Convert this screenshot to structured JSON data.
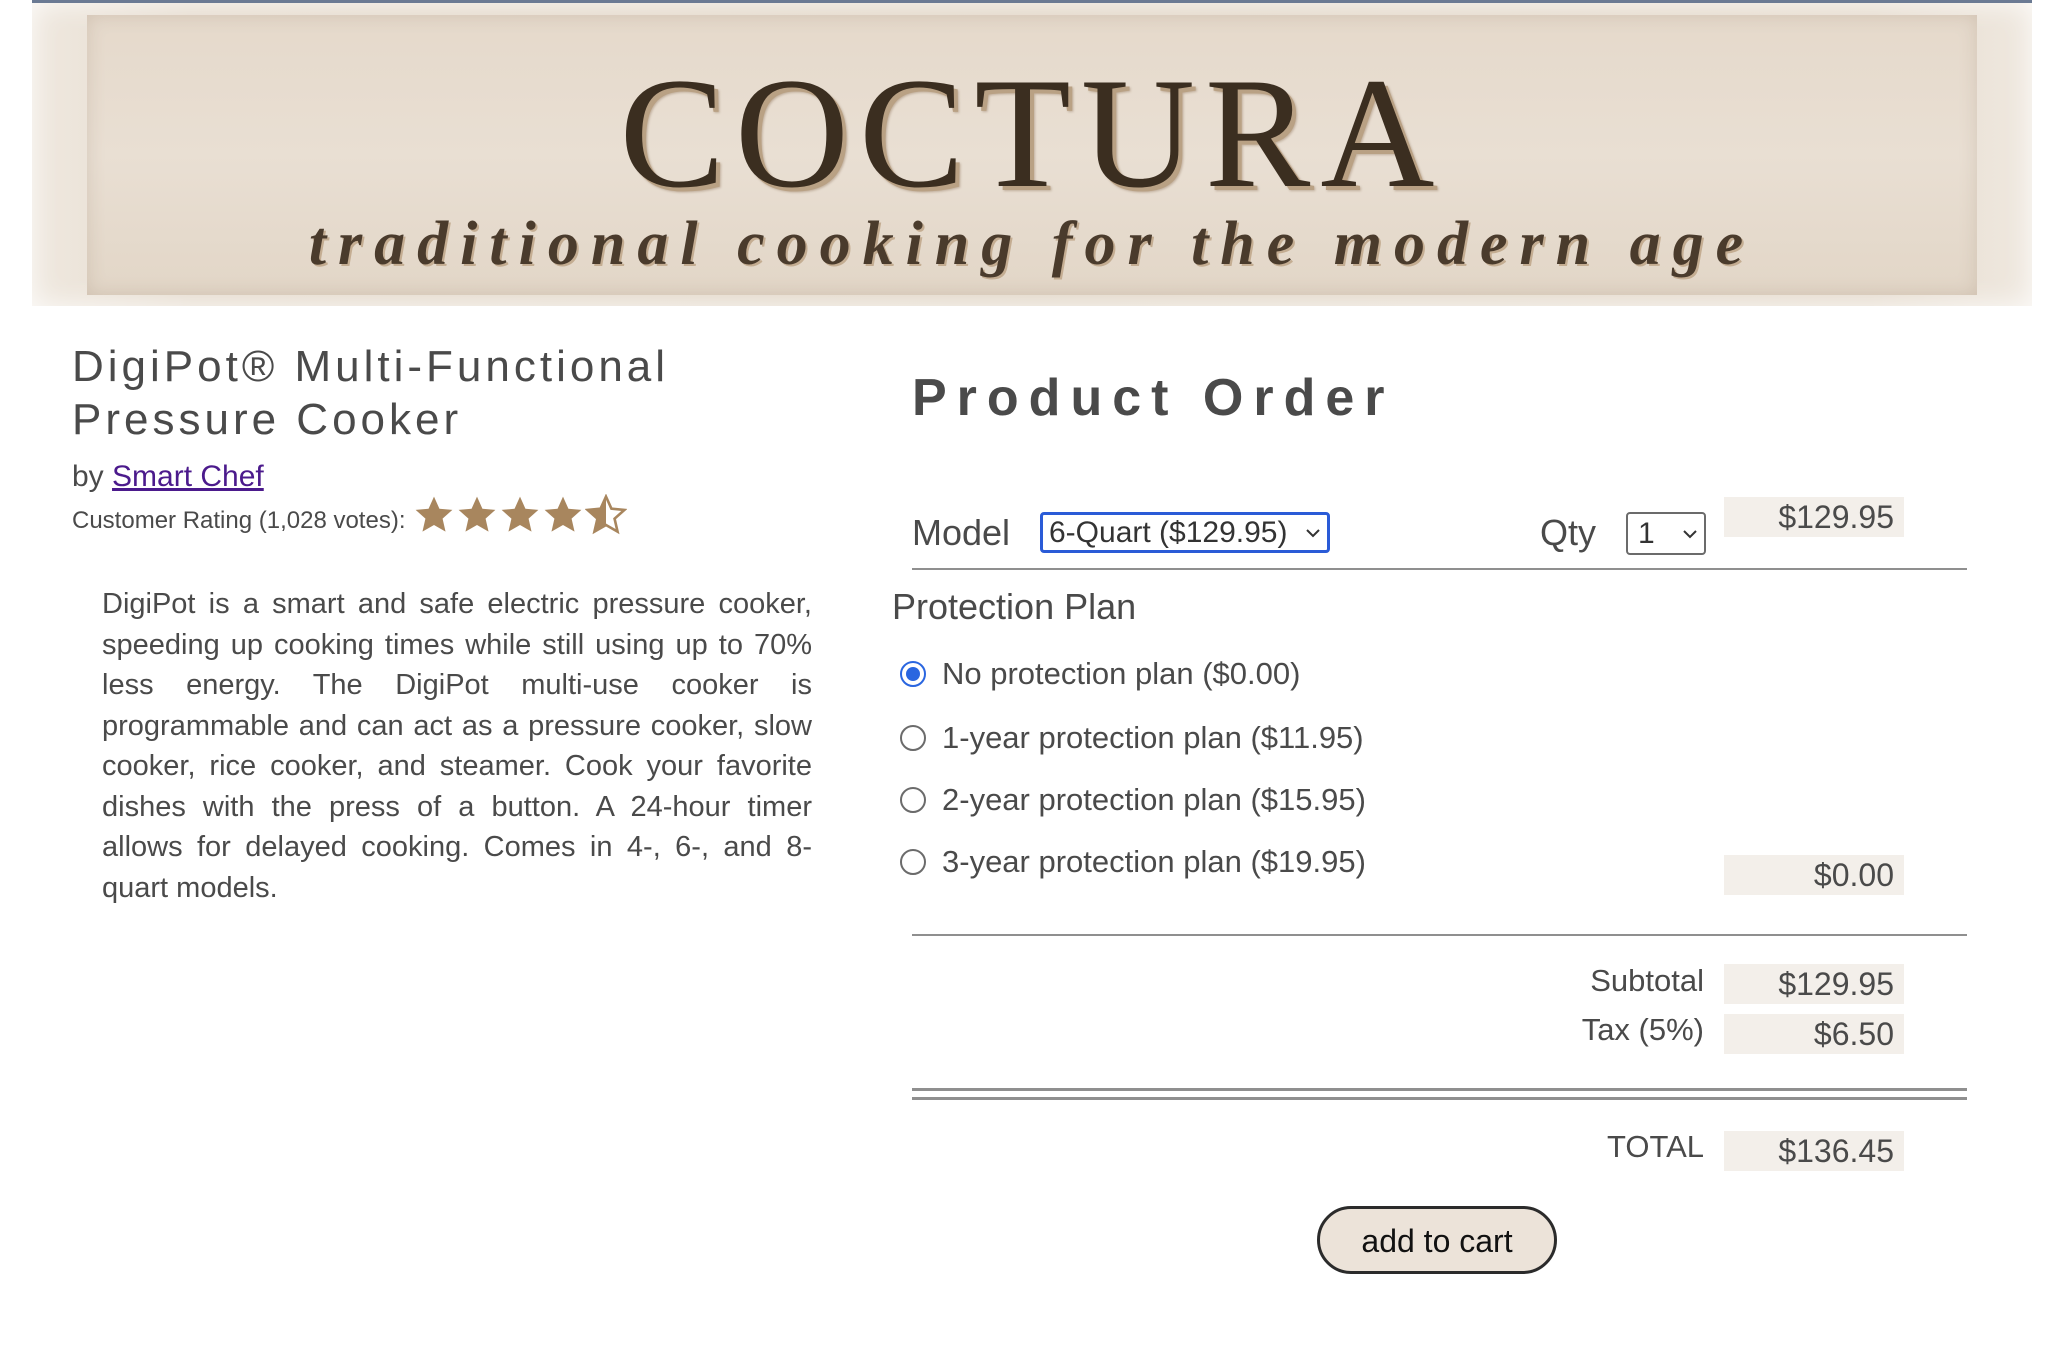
{
  "banner": {
    "brand": "COCTURA",
    "tagline": "traditional cooking for the modern age"
  },
  "product": {
    "title": "DigiPot® Multi-Functional Pressure Cooker",
    "by_prefix": "by",
    "brand_link": "Smart Chef",
    "rating_label": "Customer Rating (1,028 votes):",
    "rating": 4.5,
    "rating_max": 5,
    "description": "DigiPot is a smart and safe electric pressure cooker, speeding up cooking times while still using up to 70% less energy. The DigiPot multi-use cooker is programmable and can act as a pressure cooker, slow cooker, rice cooker, and steamer. Cook your favorite dishes with the press of a button. A 24-hour timer allows for delayed cooking. Comes in 4-, 6-, and 8-quart models."
  },
  "order": {
    "title": "Product Order",
    "model_label": "Model",
    "model_selected": "6-Quart ($129.95)",
    "qty_label": "Qty",
    "qty_selected": "1",
    "model_amount": "$129.95",
    "protection_title": "Protection Plan",
    "plans": [
      {
        "label": "No protection plan ($0.00)",
        "checked": true
      },
      {
        "label": "1-year protection plan ($11.95)",
        "checked": false
      },
      {
        "label": "2-year protection plan ($15.95)",
        "checked": false
      },
      {
        "label": "3-year protection plan ($19.95)",
        "checked": false
      }
    ],
    "plan_amount": "$0.00",
    "subtotal_label": "Subtotal",
    "subtotal_amount": "$129.95",
    "tax_label": "Tax (5%)",
    "tax_amount": "$6.50",
    "total_label": "TOTAL",
    "total_amount": "$136.45",
    "add_to_cart_label": "add to cart"
  },
  "colors": {
    "star": "#a8865e",
    "accent_blue": "#2a66e0",
    "link": "#4b1a8c",
    "banner_bg": "#e5d9cb"
  }
}
